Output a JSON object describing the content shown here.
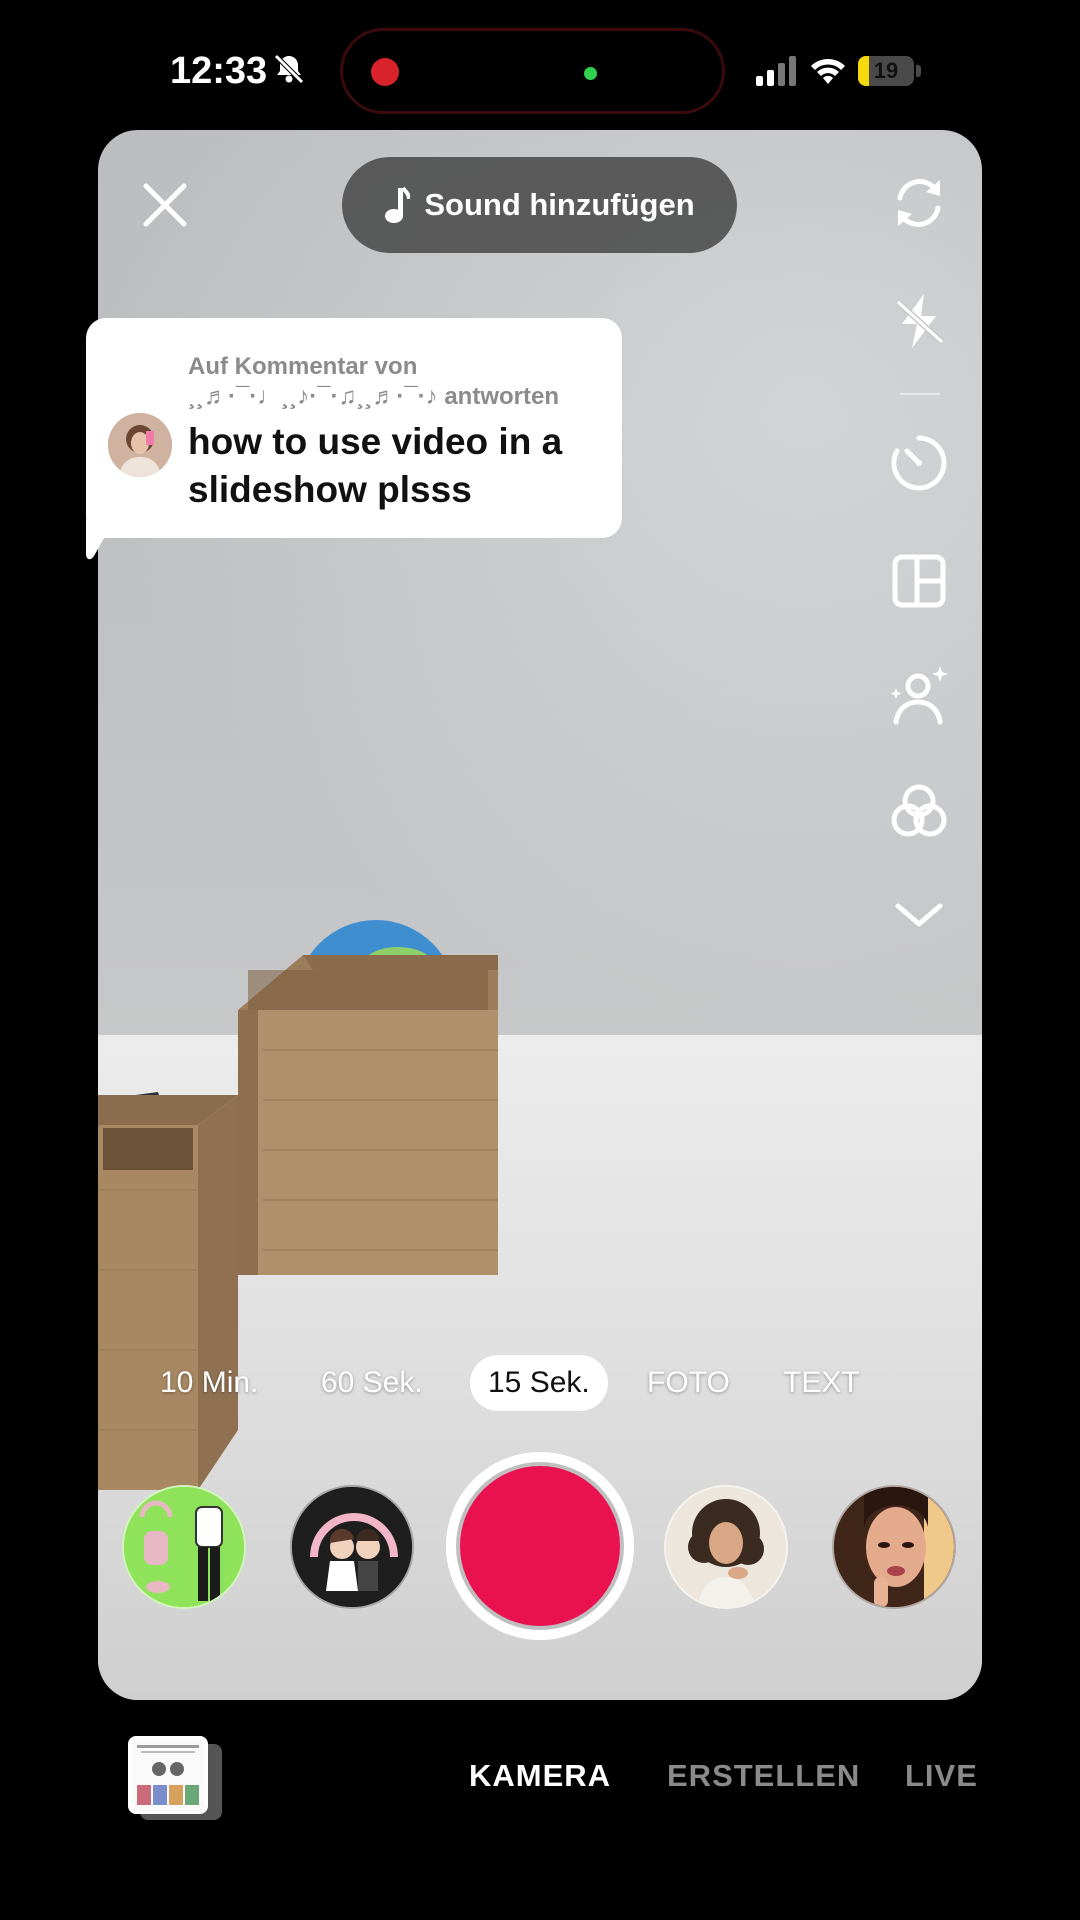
{
  "status_bar": {
    "time": "12:33",
    "battery": "19",
    "battery_level": 0.19,
    "icons": [
      "bell-slash-icon",
      "recording-dot",
      "camera-in-use-dot",
      "cellular-signal-icon",
      "wifi-icon",
      "battery-icon"
    ]
  },
  "top_bar": {
    "close_icon": "close-icon",
    "sound_label": "Sound hinzufügen",
    "sound_icon": "music-note-icon"
  },
  "toolbar": {
    "items": [
      "flip-camera-icon",
      "flash-off-icon",
      "timer-icon",
      "layout-grid-icon",
      "beauty-icon",
      "filters-icon",
      "chevron-down-icon"
    ]
  },
  "reply_bubble": {
    "header_line1": "Auf Kommentar von",
    "header_line2": "¸¸♬·¯·♩¸¸♪·¯·♫¸¸♬·¯·♪ antworten",
    "text": "how to use video in a slideshow plsss"
  },
  "durations": {
    "options": [
      "10 Min.",
      "60 Sek.",
      "15 Sek.",
      "FOTO",
      "TEXT"
    ],
    "selected": "15 Sek."
  },
  "capture_row": {
    "effects": [
      "outfit-effect",
      "wedding-couple-effect",
      "curly-hair-portrait-effect",
      "glam-portrait-effect"
    ]
  },
  "bottom_nav": {
    "tabs": [
      "KAMERA",
      "ERSTELLEN",
      "LIVE"
    ],
    "active": "KAMERA"
  },
  "colors": {
    "record": "#ea1151",
    "accent_battery": "#f5d90a",
    "rec_dot": "#d8232a",
    "cam_dot": "#2fd14f"
  }
}
